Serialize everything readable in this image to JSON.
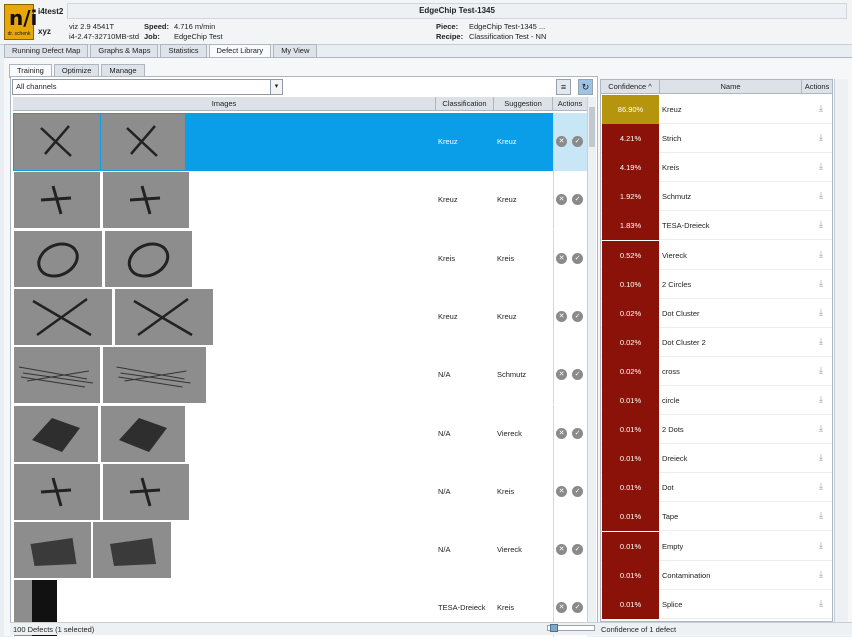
{
  "header": {
    "logo_text": "dr. schenk",
    "user_line1": "i4test2",
    "user_line2": "xyz",
    "sys_line1": "viz 2.9 4541T",
    "sys_line2": "i4-2.47-32710MB-std",
    "speed_label": "Speed:",
    "speed_value": "4.716 m/min",
    "job_label": "Job:",
    "job_value": "EdgeChip Test",
    "title": "EdgeChip Test-1345",
    "piece_label": "Piece:",
    "piece_value": "EdgeChip Test-1345 ...",
    "recipe_label": "Recipe:",
    "recipe_value": "Classification Test - NN"
  },
  "main_tabs": [
    "Running Defect Map",
    "Graphs & Maps",
    "Statistics",
    "Defect Library",
    "My View"
  ],
  "active_main_tab": "Defect Library",
  "sub_tabs": [
    "Training",
    "Optimize",
    "Manage"
  ],
  "active_sub_tab": "Training",
  "channel_select": {
    "value": "All channels"
  },
  "grid": {
    "col_images": "Images",
    "col_classification": "Classification",
    "col_suggestion": "Suggestion",
    "col_actions": "Actions",
    "rows": [
      {
        "classification": "Kreuz",
        "suggestion": "Kreuz",
        "selected": true
      },
      {
        "classification": "Kreuz",
        "suggestion": "Kreuz",
        "selected": false
      },
      {
        "classification": "Kreis",
        "suggestion": "Kreis",
        "selected": false
      },
      {
        "classification": "Kreuz",
        "suggestion": "Kreuz",
        "selected": false
      },
      {
        "classification": "N/A",
        "suggestion": "Schmutz",
        "selected": false
      },
      {
        "classification": "N/A",
        "suggestion": "Viereck",
        "selected": false
      },
      {
        "classification": "N/A",
        "suggestion": "Kreis",
        "selected": false
      },
      {
        "classification": "N/A",
        "suggestion": "Viereck",
        "selected": false
      },
      {
        "classification": "TESA-Dreieck",
        "suggestion": "Kreis",
        "selected": false
      }
    ]
  },
  "status": {
    "defects": "100 Defects (1 selected)",
    "confidence_of": "Confidence of 1 defect"
  },
  "confidence": {
    "col_confidence": "Confidence",
    "col_name": "Name",
    "col_actions": "Actions",
    "colors": {
      "top": "#b5950e",
      "other": "#8b1208"
    },
    "rows": [
      {
        "value": "86.90%",
        "name": "Kreuz"
      },
      {
        "value": "4.21%",
        "name": "Strich"
      },
      {
        "value": "4.19%",
        "name": "Kreis"
      },
      {
        "value": "1.92%",
        "name": "Schmutz"
      },
      {
        "value": "1.83%",
        "name": "TESA-Dreieck"
      },
      {
        "value": "0.52%",
        "name": "Viereck"
      },
      {
        "value": "0.10%",
        "name": "2 Circles"
      },
      {
        "value": "0.02%",
        "name": "Dot Cluster"
      },
      {
        "value": "0.02%",
        "name": "Dot Cluster 2"
      },
      {
        "value": "0.02%",
        "name": "cross"
      },
      {
        "value": "0.01%",
        "name": "circle"
      },
      {
        "value": "0.01%",
        "name": "2 Dots"
      },
      {
        "value": "0.01%",
        "name": "Dreieck"
      },
      {
        "value": "0.01%",
        "name": "Dot"
      },
      {
        "value": "0.01%",
        "name": "Tape"
      },
      {
        "value": "0.01%",
        "name": "Empty"
      },
      {
        "value": "0.01%",
        "name": "Contamination"
      },
      {
        "value": "0.01%",
        "name": "Splice"
      }
    ]
  }
}
